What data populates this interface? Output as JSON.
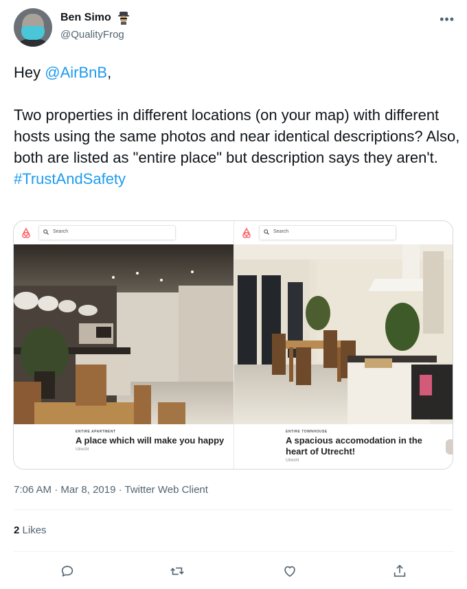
{
  "author": {
    "display_name": "Ben Simo",
    "name_emoji_icon": "detective-icon",
    "handle": "@QualityFrog",
    "avatar_icon": "avatar-with-face-mask"
  },
  "more_icon": "more-horizontal-icon",
  "tweet": {
    "greeting_prefix": "Hey ",
    "mention": "@AirBnB",
    "greeting_suffix": ",",
    "body": "Two properties in different locations (on your map) with different hosts using the same photos and near identical descriptions? Also, both are listed as \"entire place\" but description says they aren't.",
    "hashtag": "#TrustAndSafety"
  },
  "media": {
    "left": {
      "search_placeholder": "Search",
      "kind": "ENTIRE APARTMENT",
      "title": "A place which will make you happy",
      "city": "Utrecht"
    },
    "right": {
      "search_placeholder": "Search",
      "kind": "ENTIRE TOWNHOUSE",
      "title": "A spacious accomodation in the heart of Utrecht!",
      "city": "Utrecht"
    }
  },
  "meta": {
    "time": "7:06 AM",
    "date": "Mar 8, 2019",
    "client": "Twitter Web Client"
  },
  "likes": {
    "count": "2",
    "label": "Likes"
  },
  "actions": {
    "reply_icon": "reply-icon",
    "retweet_icon": "retweet-icon",
    "like_icon": "heart-icon",
    "share_icon": "share-icon"
  },
  "colors": {
    "link": "#1d9bf0",
    "text": "#0f1419",
    "secondary": "#536471",
    "airbnb": "#ff5a5f"
  }
}
